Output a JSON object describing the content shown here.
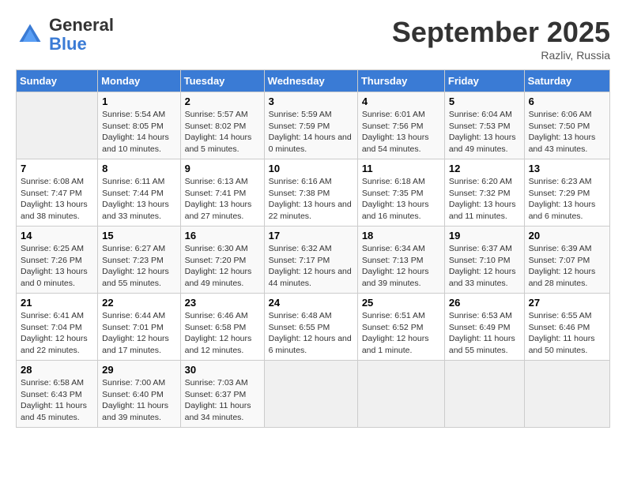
{
  "header": {
    "logo_general": "General",
    "logo_blue": "Blue",
    "month_title": "September 2025",
    "location": "Razliv, Russia"
  },
  "weekdays": [
    "Sunday",
    "Monday",
    "Tuesday",
    "Wednesday",
    "Thursday",
    "Friday",
    "Saturday"
  ],
  "weeks": [
    [
      {
        "day": "",
        "sunrise": "",
        "sunset": "",
        "daylight": ""
      },
      {
        "day": "1",
        "sunrise": "Sunrise: 5:54 AM",
        "sunset": "Sunset: 8:05 PM",
        "daylight": "Daylight: 14 hours and 10 minutes."
      },
      {
        "day": "2",
        "sunrise": "Sunrise: 5:57 AM",
        "sunset": "Sunset: 8:02 PM",
        "daylight": "Daylight: 14 hours and 5 minutes."
      },
      {
        "day": "3",
        "sunrise": "Sunrise: 5:59 AM",
        "sunset": "Sunset: 7:59 PM",
        "daylight": "Daylight: 14 hours and 0 minutes."
      },
      {
        "day": "4",
        "sunrise": "Sunrise: 6:01 AM",
        "sunset": "Sunset: 7:56 PM",
        "daylight": "Daylight: 13 hours and 54 minutes."
      },
      {
        "day": "5",
        "sunrise": "Sunrise: 6:04 AM",
        "sunset": "Sunset: 7:53 PM",
        "daylight": "Daylight: 13 hours and 49 minutes."
      },
      {
        "day": "6",
        "sunrise": "Sunrise: 6:06 AM",
        "sunset": "Sunset: 7:50 PM",
        "daylight": "Daylight: 13 hours and 43 minutes."
      }
    ],
    [
      {
        "day": "7",
        "sunrise": "Sunrise: 6:08 AM",
        "sunset": "Sunset: 7:47 PM",
        "daylight": "Daylight: 13 hours and 38 minutes."
      },
      {
        "day": "8",
        "sunrise": "Sunrise: 6:11 AM",
        "sunset": "Sunset: 7:44 PM",
        "daylight": "Daylight: 13 hours and 33 minutes."
      },
      {
        "day": "9",
        "sunrise": "Sunrise: 6:13 AM",
        "sunset": "Sunset: 7:41 PM",
        "daylight": "Daylight: 13 hours and 27 minutes."
      },
      {
        "day": "10",
        "sunrise": "Sunrise: 6:16 AM",
        "sunset": "Sunset: 7:38 PM",
        "daylight": "Daylight: 13 hours and 22 minutes."
      },
      {
        "day": "11",
        "sunrise": "Sunrise: 6:18 AM",
        "sunset": "Sunset: 7:35 PM",
        "daylight": "Daylight: 13 hours and 16 minutes."
      },
      {
        "day": "12",
        "sunrise": "Sunrise: 6:20 AM",
        "sunset": "Sunset: 7:32 PM",
        "daylight": "Daylight: 13 hours and 11 minutes."
      },
      {
        "day": "13",
        "sunrise": "Sunrise: 6:23 AM",
        "sunset": "Sunset: 7:29 PM",
        "daylight": "Daylight: 13 hours and 6 minutes."
      }
    ],
    [
      {
        "day": "14",
        "sunrise": "Sunrise: 6:25 AM",
        "sunset": "Sunset: 7:26 PM",
        "daylight": "Daylight: 13 hours and 0 minutes."
      },
      {
        "day": "15",
        "sunrise": "Sunrise: 6:27 AM",
        "sunset": "Sunset: 7:23 PM",
        "daylight": "Daylight: 12 hours and 55 minutes."
      },
      {
        "day": "16",
        "sunrise": "Sunrise: 6:30 AM",
        "sunset": "Sunset: 7:20 PM",
        "daylight": "Daylight: 12 hours and 49 minutes."
      },
      {
        "day": "17",
        "sunrise": "Sunrise: 6:32 AM",
        "sunset": "Sunset: 7:17 PM",
        "daylight": "Daylight: 12 hours and 44 minutes."
      },
      {
        "day": "18",
        "sunrise": "Sunrise: 6:34 AM",
        "sunset": "Sunset: 7:13 PM",
        "daylight": "Daylight: 12 hours and 39 minutes."
      },
      {
        "day": "19",
        "sunrise": "Sunrise: 6:37 AM",
        "sunset": "Sunset: 7:10 PM",
        "daylight": "Daylight: 12 hours and 33 minutes."
      },
      {
        "day": "20",
        "sunrise": "Sunrise: 6:39 AM",
        "sunset": "Sunset: 7:07 PM",
        "daylight": "Daylight: 12 hours and 28 minutes."
      }
    ],
    [
      {
        "day": "21",
        "sunrise": "Sunrise: 6:41 AM",
        "sunset": "Sunset: 7:04 PM",
        "daylight": "Daylight: 12 hours and 22 minutes."
      },
      {
        "day": "22",
        "sunrise": "Sunrise: 6:44 AM",
        "sunset": "Sunset: 7:01 PM",
        "daylight": "Daylight: 12 hours and 17 minutes."
      },
      {
        "day": "23",
        "sunrise": "Sunrise: 6:46 AM",
        "sunset": "Sunset: 6:58 PM",
        "daylight": "Daylight: 12 hours and 12 minutes."
      },
      {
        "day": "24",
        "sunrise": "Sunrise: 6:48 AM",
        "sunset": "Sunset: 6:55 PM",
        "daylight": "Daylight: 12 hours and 6 minutes."
      },
      {
        "day": "25",
        "sunrise": "Sunrise: 6:51 AM",
        "sunset": "Sunset: 6:52 PM",
        "daylight": "Daylight: 12 hours and 1 minute."
      },
      {
        "day": "26",
        "sunrise": "Sunrise: 6:53 AM",
        "sunset": "Sunset: 6:49 PM",
        "daylight": "Daylight: 11 hours and 55 minutes."
      },
      {
        "day": "27",
        "sunrise": "Sunrise: 6:55 AM",
        "sunset": "Sunset: 6:46 PM",
        "daylight": "Daylight: 11 hours and 50 minutes."
      }
    ],
    [
      {
        "day": "28",
        "sunrise": "Sunrise: 6:58 AM",
        "sunset": "Sunset: 6:43 PM",
        "daylight": "Daylight: 11 hours and 45 minutes."
      },
      {
        "day": "29",
        "sunrise": "Sunrise: 7:00 AM",
        "sunset": "Sunset: 6:40 PM",
        "daylight": "Daylight: 11 hours and 39 minutes."
      },
      {
        "day": "30",
        "sunrise": "Sunrise: 7:03 AM",
        "sunset": "Sunset: 6:37 PM",
        "daylight": "Daylight: 11 hours and 34 minutes."
      },
      {
        "day": "",
        "sunrise": "",
        "sunset": "",
        "daylight": ""
      },
      {
        "day": "",
        "sunrise": "",
        "sunset": "",
        "daylight": ""
      },
      {
        "day": "",
        "sunrise": "",
        "sunset": "",
        "daylight": ""
      },
      {
        "day": "",
        "sunrise": "",
        "sunset": "",
        "daylight": ""
      }
    ]
  ]
}
